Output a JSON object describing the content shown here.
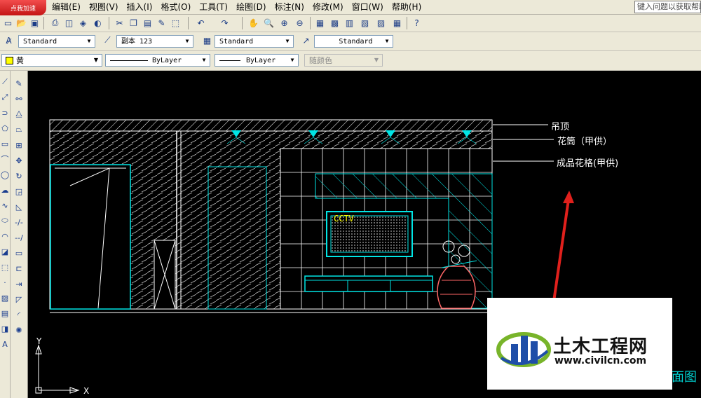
{
  "app": {
    "badge": "点我加速",
    "help_search": "键入问题以获取帮助"
  },
  "menus": [
    "编辑(E)",
    "视图(V)",
    "插入(I)",
    "格式(O)",
    "工具(T)",
    "绘图(D)",
    "标注(N)",
    "修改(M)",
    "窗口(W)",
    "帮助(H)"
  ],
  "toolbar2": {
    "text_style": "Standard",
    "dim_style": "副本 123",
    "table_style": "Standard",
    "mleader_style": "Standard"
  },
  "toolbar3": {
    "color": "黄",
    "linetype": "ByLayer",
    "lineweight": "ByLayer",
    "plotstyle": "随颜色"
  },
  "colors": {
    "layer_color": "#ffff00",
    "cyan": "#00e5e5",
    "arrow": "#e0201c"
  },
  "drawing": {
    "labels": [
      "吊顶",
      "花筒（甲供）",
      "成品花格(甲供)"
    ],
    "tv_text": "CCTV",
    "partial_title": "面图",
    "axis_x": "X",
    "axis_y": "Y"
  },
  "watermark": {
    "title": "土木工程网",
    "url": "www.civilcn.com"
  }
}
